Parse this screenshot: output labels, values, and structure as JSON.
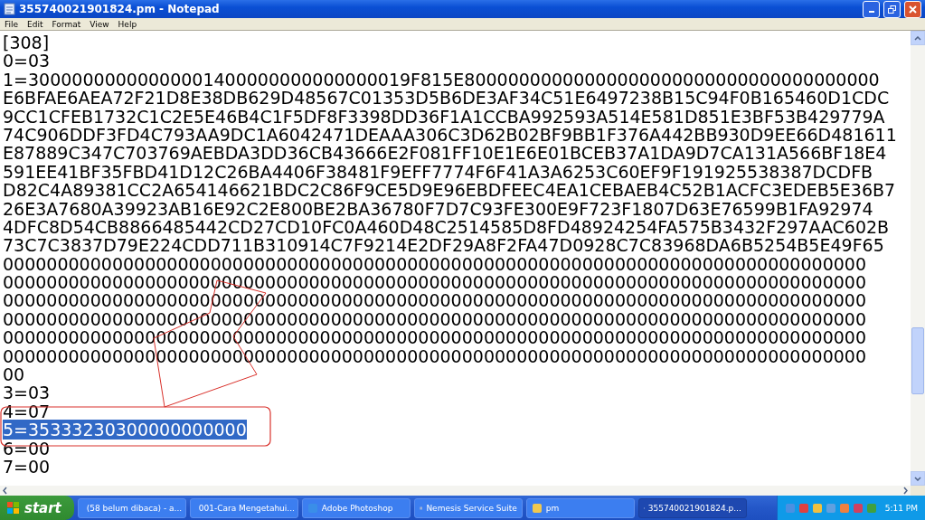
{
  "window": {
    "title": "355740021901824.pm - Notepad"
  },
  "menu": [
    "File",
    "Edit",
    "Format",
    "View",
    "Help"
  ],
  "lines": [
    {
      "text": "[308]",
      "selected": false
    },
    {
      "text": "0=03",
      "selected": false
    },
    {
      "text": "1=30000000000000001400000000000000019F815E80000000000000000000000000000000000000",
      "selected": false
    },
    {
      "text": "E6BFAE6AEA72F21D8E38DB629D48567C01353D5B6DE3AF34C51E6497238B15C94F0B165460D1CDC",
      "selected": false
    },
    {
      "text": "9CC1CFEB1732C1C2E5E46B4C1F5DF8F3398DD36F1A1CCBA992593A514E581D851E3BF53B429779A",
      "selected": false
    },
    {
      "text": "74C906DDF3FD4C793AA9DC1A6042471DEAAA306C3D62B02BF9BB1F376A442BB930D9EE66D481611",
      "selected": false
    },
    {
      "text": "E87889C347C703769AEBDA3DD36CB43666E2F081FF10E1E6E01BCEB37A1DA9D7CA131A566BF18E4",
      "selected": false
    },
    {
      "text": "591EE41BF35FBD41D12C26BA4406F38481F9EFF7774F6F41A3A6253C60EF9F191925538387DCDFB",
      "selected": false
    },
    {
      "text": "D82C4A89381CC2A654146621BDC2C86F9CE5D9E96EBDFEEC4EA1CEBAEB4C52B1ACFC3EDEB5E36B7",
      "selected": false
    },
    {
      "text": "26E3A7680A39923AB16E92C2E800BE2BA36780F7D7C93FE300E9F723F1807D63E76599B1FA92974",
      "selected": false
    },
    {
      "text": "4DFC8D54CB8866485442CD27CD10FC0A460D48C2514585D8FD48924254FA575B3432F297AAC602B",
      "selected": false
    },
    {
      "text": "73C7C3837D79E224CDD711B310914C7F9214E2DF29A8F2FA47D0928C7C83968DA6B5254B5E49F65",
      "selected": false
    },
    {
      "text": "0000000000000000000000000000000000000000000000000000000000000000000000000000000",
      "selected": false
    },
    {
      "text": "0000000000000000000000000000000000000000000000000000000000000000000000000000000",
      "selected": false
    },
    {
      "text": "0000000000000000000000000000000000000000000000000000000000000000000000000000000",
      "selected": false
    },
    {
      "text": "0000000000000000000000000000000000000000000000000000000000000000000000000000000",
      "selected": false
    },
    {
      "text": "0000000000000000000000000000000000000000000000000000000000000000000000000000000",
      "selected": false
    },
    {
      "text": "0000000000000000000000000000000000000000000000000000000000000000000000000000000",
      "selected": false
    },
    {
      "text": "00",
      "selected": false
    },
    {
      "text": "3=03",
      "selected": false
    },
    {
      "text": "4=07",
      "selected": false
    },
    {
      "text": "5=35333230300000000000",
      "selected": true
    },
    {
      "text": "6=00",
      "selected": false
    },
    {
      "text": "7=00",
      "selected": false
    }
  ],
  "taskbar": {
    "start": "start",
    "items": [
      {
        "label": "(58 belum dibaca) - a...",
        "selected": false
      },
      {
        "label": "001-Cara Mengetahui...",
        "selected": false
      },
      {
        "label": "Adobe Photoshop",
        "selected": false
      },
      {
        "label": "Nemesis Service Suite",
        "selected": false
      },
      {
        "label": "pm",
        "selected": false
      },
      {
        "label": "355740021901824.p...",
        "selected": true
      }
    ],
    "clock": "5:11 PM"
  }
}
